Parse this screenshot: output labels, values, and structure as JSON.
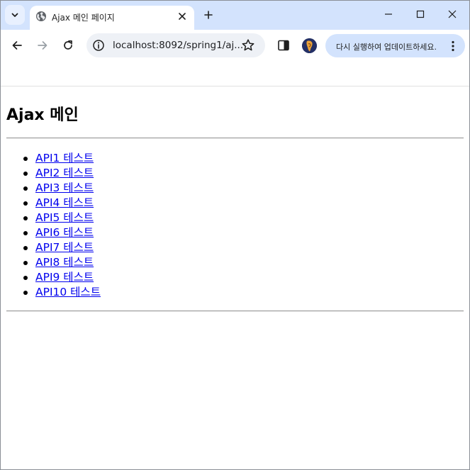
{
  "browser": {
    "tab_title": "Ajax 메인 페이지",
    "address": "localhost:8092/spring1/aj...",
    "update_button_label": "다시 실행하여 업데이트하세요.",
    "colors": {
      "tabstrip": "#d3e3fd",
      "omnibox": "#eef1f6",
      "update_chip": "#d3e3fd"
    }
  },
  "page": {
    "heading": "Ajax 메인",
    "links": [
      {
        "label": "API1 테스트"
      },
      {
        "label": "API2 테스트"
      },
      {
        "label": "API3 테스트"
      },
      {
        "label": "API4 테스트"
      },
      {
        "label": "API5 테스트"
      },
      {
        "label": "API6 테스트"
      },
      {
        "label": "API7 테스트"
      },
      {
        "label": "API8 테스트"
      },
      {
        "label": "API9 테스트"
      },
      {
        "label": "API10 테스트"
      }
    ],
    "link_color": "#0000ee"
  },
  "icons": [
    "tab-search-icon",
    "globe-icon",
    "close-icon",
    "plus-icon",
    "minimize-icon",
    "maximize-icon",
    "window-close-icon",
    "back-icon",
    "forward-icon",
    "reload-icon",
    "info-icon",
    "star-icon",
    "side-panel-icon",
    "avatar",
    "more-vert-icon"
  ]
}
